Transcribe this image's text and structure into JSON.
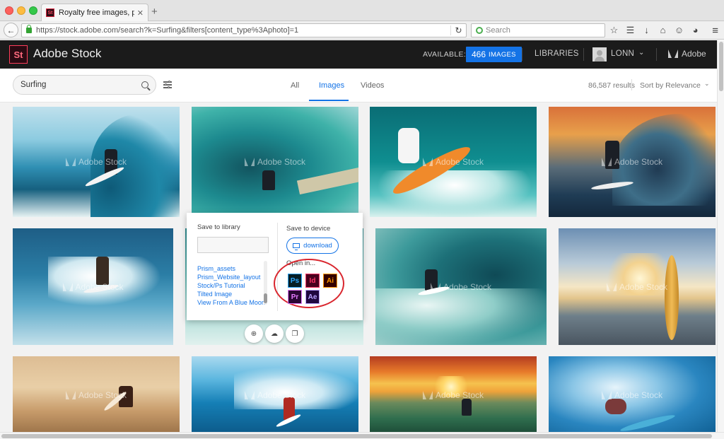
{
  "browser": {
    "tab_title": "Royalty free images, photos…",
    "tab_close": "✕",
    "new_tab": "+",
    "url": "https://stock.adobe.com/search?k=Surfing&filters[content_type%3Aphoto]=1",
    "search_placeholder": "Search"
  },
  "header": {
    "logo": "St",
    "brand": "Adobe Stock",
    "available_label": "AVAILABLE:",
    "images_count": "466",
    "images_label": "IMAGES",
    "libraries": "LIBRARIES",
    "user": "LONN",
    "adobe": "Adobe"
  },
  "filters": {
    "search_value": "Surfing",
    "tabs": [
      "All",
      "Images",
      "Videos"
    ],
    "active_tab": "Images",
    "results": "86,587 results",
    "sort": "Sort by Relevance"
  },
  "watermark": "Adobe Stock",
  "popover": {
    "save_to_library": "Save to library",
    "save_to_device": "Save to device",
    "download": "download",
    "open_in": "Open in...",
    "libraries": [
      "Prism_assets",
      "Prism_Website_layout",
      "Stock/Ps Tutorial",
      "Tilted Image",
      "View From A Blue Moon"
    ],
    "apps": [
      {
        "label": "Ps",
        "name": "photoshop-icon",
        "fg": "#31a8ff",
        "bg": "#061e26"
      },
      {
        "label": "Id",
        "name": "indesign-icon",
        "fg": "#ff3366",
        "bg": "#49021f"
      },
      {
        "label": "Ai",
        "name": "illustrator-icon",
        "fg": "#ff9a00",
        "bg": "#330000"
      },
      {
        "label": "Pr",
        "name": "premiere-icon",
        "fg": "#e77cff",
        "bg": "#2a0634"
      },
      {
        "label": "Ae",
        "name": "aftereffects-icon",
        "fg": "#b9a3ff",
        "bg": "#1f0740"
      }
    ]
  },
  "colors": {
    "accent": "#1473e6",
    "header_bg": "#1b1b1b",
    "highlight": "#d9262e"
  }
}
